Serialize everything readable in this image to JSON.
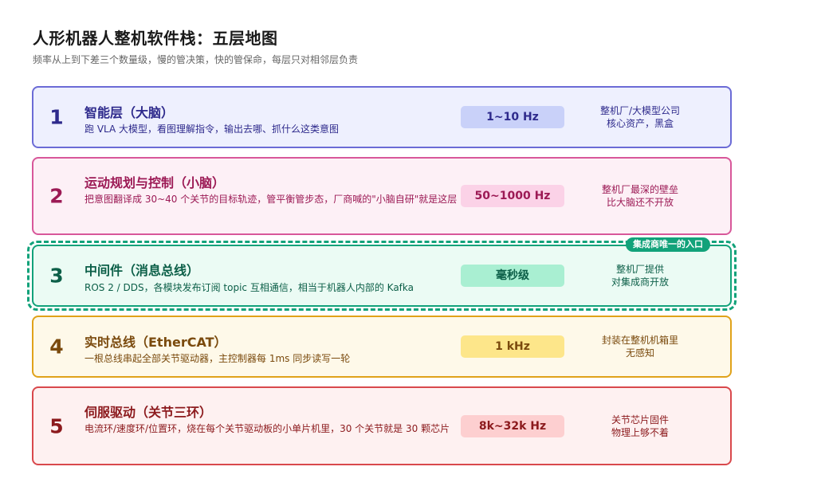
{
  "title": "人形机器人整机软件栈：五层地图",
  "subtitle": "频率从上到下差三个数量级，慢的管决策，快的管保命，每层只对相邻层负责",
  "badge": "集成商唯一的入口",
  "layers": [
    {
      "num": "1",
      "name": "智能层（大脑）",
      "desc": "跑 VLA 大模型，看图理解指令，输出去哪、抓什么这类意图",
      "freq": "1~10 Hz",
      "note": [
        "整机厂/大模型公司",
        "核心资产，黑盒"
      ],
      "colors": {
        "border": "#6b6bd6",
        "bg": "#eef0fe",
        "text": "#2e2a8c",
        "pill": "#c9d1f9",
        "pill_text": "#2e2a8c"
      }
    },
    {
      "num": "2",
      "name": "运动规划与控制（小脑）",
      "desc": "把意图翻译成 30~40 个关节的目标轨迹，管平衡管步态，厂商喊的\"小脑自研\"就是这层",
      "freq": "50~1000 Hz",
      "note": [
        "整机厂最深的壁垒",
        "比大脑还不开放"
      ],
      "colors": {
        "border": "#d8579a",
        "bg": "#fdf0f6",
        "text": "#9c1a55",
        "pill": "#fbd2e7",
        "pill_text": "#9c1a55"
      }
    },
    {
      "num": "3",
      "name": "中间件（消息总线）",
      "desc": "ROS 2 / DDS，各模块发布订阅 topic 互相通信，相当于机器人内部的 Kafka",
      "freq": "毫秒级",
      "note": [
        "整机厂提供",
        "对集成商开放"
      ],
      "colors": {
        "border": "#12a27a",
        "bg": "#ebfbf4",
        "text": "#0c5f48",
        "pill": "#a9efd2",
        "pill_text": "#0c5f48"
      }
    },
    {
      "num": "4",
      "name": "实时总线（EtherCAT）",
      "desc": "一根总线串起全部关节驱动器，主控制器每 1ms 同步读写一轮",
      "freq": "1 kHz",
      "note": [
        "封装在整机机箱里",
        "无感知"
      ],
      "colors": {
        "border": "#e0a21a",
        "bg": "#fef9e9",
        "text": "#7a4a0d",
        "pill": "#fde68a",
        "pill_text": "#7a4a0d"
      }
    },
    {
      "num": "5",
      "name": "伺服驱动（关节三环）",
      "desc": "电流环/速度环/位置环，烧在每个关节驱动板的小单片机里，30 个关节就是 30 颗芯片",
      "freq": "8k~32k Hz",
      "note": [
        "关节芯片固件",
        "物理上够不着"
      ],
      "colors": {
        "border": "#d9484c",
        "bg": "#fef1f1",
        "text": "#8c1a1d",
        "pill": "#fdcfd0",
        "pill_text": "#8c1a1d"
      }
    }
  ]
}
